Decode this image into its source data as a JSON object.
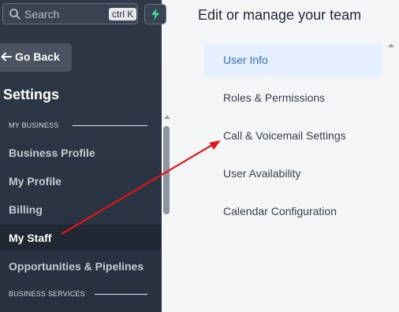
{
  "search": {
    "placeholder": "Search",
    "shortcut": "ctrl K"
  },
  "sidebar": {
    "go_back": "Go Back",
    "title": "Settings",
    "sections": [
      {
        "label": "MY BUSINESS"
      },
      {
        "label": "BUSINESS SERVICES"
      }
    ],
    "items": [
      {
        "label": "Business Profile"
      },
      {
        "label": "My Profile"
      },
      {
        "label": "Billing"
      },
      {
        "label": "My Staff",
        "active": true
      },
      {
        "label": "Opportunities & Pipelines"
      }
    ]
  },
  "main": {
    "title": "Edit or manage your team",
    "menu": [
      {
        "label": "User Info",
        "active": true
      },
      {
        "label": "Roles & Permissions"
      },
      {
        "label": "Call & Voicemail Settings"
      },
      {
        "label": "User Availability"
      },
      {
        "label": "Calendar Configuration"
      }
    ]
  },
  "colors": {
    "sidebar_bg": "#2b3442",
    "active_item_bg": "#1f2733",
    "menu_active_bg": "#e5efff",
    "menu_active_text": "#2f6fd0",
    "bolt": "#3ddc97",
    "annotation_arrow": "#e0161b"
  },
  "icons": {
    "search": "search-icon",
    "bolt": "lightning-bolt-icon",
    "back": "arrow-left-icon"
  }
}
